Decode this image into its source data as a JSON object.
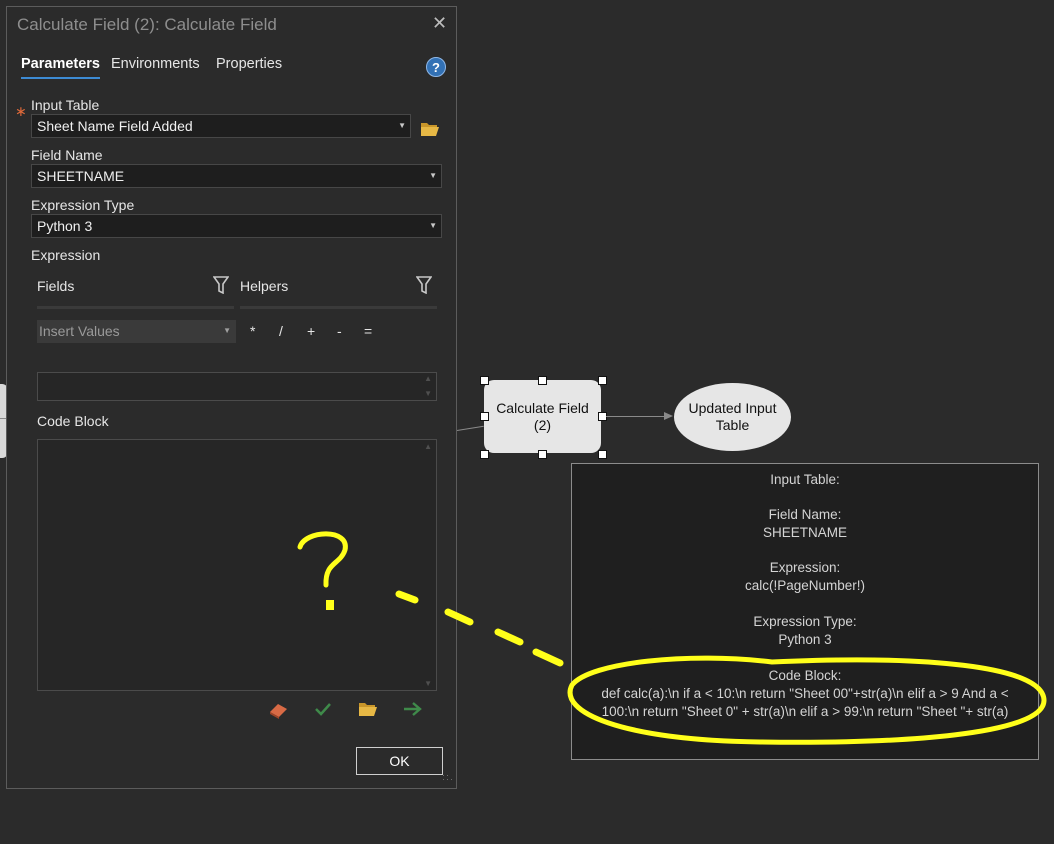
{
  "dialog": {
    "title": "Calculate Field (2): Calculate Field",
    "close_glyph": "✕",
    "tabs": [
      {
        "label": "Parameters",
        "active": true
      },
      {
        "label": "Environments",
        "active": false
      },
      {
        "label": "Properties",
        "active": false
      }
    ],
    "help_icon": "question-circle-icon",
    "help_glyph": "?",
    "required_marker": "∗",
    "input_table": {
      "label": "Input Table",
      "value": "Sheet Name Field Added",
      "browse_icon": "folder-open-icon"
    },
    "field_name": {
      "label": "Field Name",
      "value": "SHEETNAME"
    },
    "expression_type": {
      "label": "Expression Type",
      "value": "Python 3"
    },
    "expression": {
      "label": "Expression",
      "fields_label": "Fields",
      "helpers_label": "Helpers",
      "insert_values_placeholder": "Insert Values",
      "operators": [
        "*",
        "/",
        "+",
        "-",
        "="
      ]
    },
    "code_block": {
      "label": "Code Block"
    },
    "code_block_tools": [
      "eraser-icon",
      "checkmark-icon",
      "folder-open-icon",
      "arrow-right-icon"
    ],
    "ok_label": "OK"
  },
  "model": {
    "tool_node": {
      "label_line1": "Calculate Field",
      "label_line2": "(2)"
    },
    "output_node": {
      "label_line1": "Updated Input",
      "label_line2": "Table"
    }
  },
  "tooltip": {
    "input_table_label": "Input Table:",
    "field_name_label": "Field Name:",
    "field_name_value": "SHEETNAME",
    "expression_label": "Expression:",
    "expression_value": "calc(!PageNumber!)",
    "expression_type_label": "Expression Type:",
    "expression_type_value": "Python 3",
    "code_block_label": "Code Block:",
    "code_block_line1": "def calc(a):\\n  if a < 10:\\n    return \"Sheet 00\"+str(a)\\n  elif a > 9 And a <",
    "code_block_line2": "100:\\n    return \"Sheet 0\" + str(a)\\n  elif a > 99:\\n    return \"Sheet \"+ str(a)"
  },
  "annotation": {
    "mark": "?",
    "color": "#ffff1a"
  },
  "colors": {
    "accent": "#3d8bd4",
    "required": "#e06a3a",
    "folder": "#e0b13a",
    "eraser": "#d86a45",
    "check": "#3f8a4a",
    "run_arrow": "#3f8a4a"
  }
}
